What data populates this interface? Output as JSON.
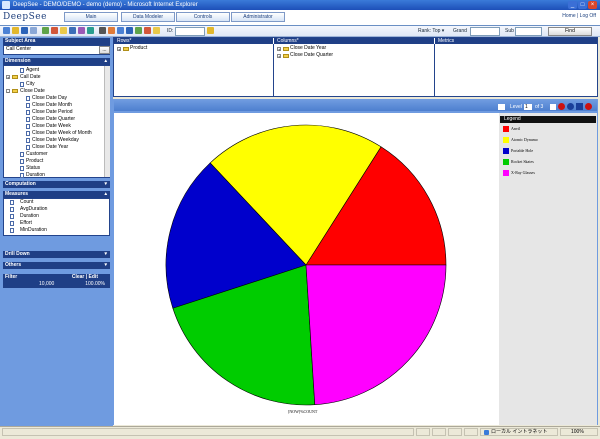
{
  "window": {
    "title": "DeepSee - DEMO/DEMO - demo (demo) - Microsoft Internet Explorer",
    "controls": [
      "_",
      "□",
      "×"
    ]
  },
  "app": {
    "logo": "DeepSee",
    "nav": [
      "Main",
      "Data Modeler",
      "Controls",
      "Administrator"
    ],
    "home_links": "Home | Log Off"
  },
  "toolbar": {
    "id_label": "ID:",
    "rank_label": "Rank: Top ▾",
    "grand_label": "Grand",
    "sub_label": "Sub",
    "find_label": "Find"
  },
  "left": {
    "subject_area_header": "Subject Area",
    "subject_area_value": "Call Center",
    "subject_area_btn": "...",
    "dimension_header": "Dimension",
    "dimensions": [
      {
        "label": "Agent",
        "kind": "doc",
        "level": 1
      },
      {
        "label": "Call Date",
        "kind": "folder",
        "level": 0,
        "pm": "+"
      },
      {
        "label": "City",
        "kind": "doc",
        "level": 1
      },
      {
        "label": "Close Date",
        "kind": "folder",
        "level": 0,
        "pm": "-"
      },
      {
        "label": "Close Date Day",
        "kind": "doc",
        "level": 2
      },
      {
        "label": "Close Date Month",
        "kind": "doc",
        "level": 2
      },
      {
        "label": "Close Date Period",
        "kind": "doc",
        "level": 2
      },
      {
        "label": "Close Date Quarter",
        "kind": "doc",
        "level": 2
      },
      {
        "label": "Close Date Week",
        "kind": "doc",
        "level": 2
      },
      {
        "label": "Close Date Week of Month",
        "kind": "doc",
        "level": 2
      },
      {
        "label": "Close Date Weekday",
        "kind": "doc",
        "level": 2
      },
      {
        "label": "Close Date Year",
        "kind": "doc",
        "level": 2
      },
      {
        "label": "Customer",
        "kind": "doc",
        "level": 1
      },
      {
        "label": "Product",
        "kind": "doc",
        "level": 1
      },
      {
        "label": "Status",
        "kind": "doc",
        "level": 1
      },
      {
        "label": "Duration",
        "kind": "doc",
        "level": 1
      }
    ],
    "computation_header": "Computation",
    "measures_header": "Measures",
    "measures": [
      "Count",
      "AvgDuration",
      "Duration",
      "Effort",
      "MinDuration"
    ],
    "drilldown_header": "Drill Down",
    "others_header": "Others",
    "filter_header": "Filter",
    "filter_actions": "Clear | Edit",
    "filter_row": {
      "count": "10,000",
      "pct": "100.00%"
    }
  },
  "panes": {
    "rows": {
      "header": "Rows*",
      "items": [
        "Product"
      ]
    },
    "columns": {
      "header": "Columns*",
      "items": [
        "Close Date Year",
        "Close Date Quarter"
      ]
    },
    "metrics": {
      "header": "Metrics"
    }
  },
  "chart_controls": {
    "label": "Level",
    "value": "1",
    "of": "of 3"
  },
  "legend": {
    "title": "Legend",
    "items": [
      {
        "label": "Anvil",
        "color": "#ff0000"
      },
      {
        "label": "Atomic Dynamo",
        "color": "#ffff00"
      },
      {
        "label": "Portable Hole",
        "color": "#0000cc"
      },
      {
        "label": "Rocket Skates",
        "color": "#00cc00"
      },
      {
        "label": "X-Ray Glasses",
        "color": "#ff00ff"
      }
    ]
  },
  "chart_data": {
    "type": "pie",
    "categories": [
      "Anvil",
      "Atomic Dynamo",
      "Portable Hole",
      "Rocket Skates",
      "X-Ray Glasses"
    ],
    "values": [
      16,
      21,
      18,
      21,
      24
    ],
    "colors": [
      "#ff0000",
      "#ffff00",
      "#0000cc",
      "#00cc00",
      "#ff00ff"
    ],
    "start_angle_deg": 0,
    "direction": "counterclockwise",
    "xlabel": "[NOW]%COUNT"
  },
  "statusbar": {
    "zone": "ローカル イントラネット",
    "zoom": "100%"
  }
}
